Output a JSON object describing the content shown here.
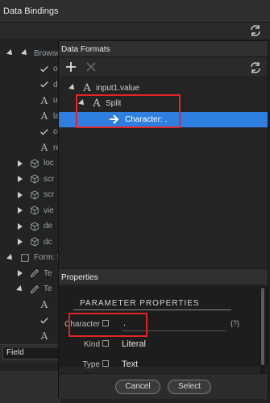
{
  "outer": {
    "title": "Data Bindings",
    "tree": [
      {
        "label": "Browse",
        "icon": "triangle-down-icon",
        "indent": 0
      },
      {
        "label": "on",
        "icon": "check-icon",
        "indent": 2
      },
      {
        "label": "dc",
        "icon": "check-icon",
        "indent": 2
      },
      {
        "label": "us",
        "icon": "font-a-icon",
        "indent": 2
      },
      {
        "label": "lar",
        "icon": "font-a-icon",
        "indent": 2
      },
      {
        "label": "co",
        "icon": "check-icon",
        "indent": 2
      },
      {
        "label": "ref",
        "icon": "font-a-icon",
        "indent": 2
      },
      {
        "label": "loc",
        "icon": "cube-icon",
        "indent": 1
      },
      {
        "label": "scr",
        "icon": "cube-icon",
        "indent": 1
      },
      {
        "label": "scr",
        "icon": "cube-icon",
        "indent": 1
      },
      {
        "label": "vie",
        "icon": "cube-icon",
        "indent": 1
      },
      {
        "label": "de",
        "icon": "cube-icon",
        "indent": 1
      },
      {
        "label": "dc",
        "icon": "cube-icon",
        "indent": 1
      },
      {
        "label": "Form: f",
        "icon": "form-icon",
        "indent": 0
      },
      {
        "label": "Te",
        "icon": "pencil-icon",
        "indent": 1
      },
      {
        "label": "Te",
        "icon": "pencil-icon",
        "indent": 1
      },
      {
        "label": "",
        "icon": "font-a-icon",
        "indent": 2
      },
      {
        "label": "",
        "icon": "check-icon",
        "indent": 2
      },
      {
        "label": "",
        "icon": "font-a-icon",
        "indent": 2
      }
    ],
    "field_select": "Field"
  },
  "data_formats": {
    "title": "Data Formats",
    "add_icon": "plus-icon",
    "remove_icon": "close-icon",
    "refresh_icon": "refresh-icon",
    "rows": [
      {
        "label": "input1.value",
        "icon": "font-a-icon"
      },
      {
        "label": "Split",
        "icon": "font-a-icon"
      },
      {
        "label": "Character: .",
        "icon": "arrow-right-icon"
      }
    ]
  },
  "properties": {
    "title": "Properties",
    "heading": "PARAMETER PROPERTIES",
    "fields": [
      {
        "label": "Character",
        "value": "."
      },
      {
        "label": "Kind",
        "value": "Literal"
      },
      {
        "label": "Type",
        "value": "Text"
      }
    ],
    "variable_icon": "{?}"
  },
  "buttons": {
    "cancel": "Cancel",
    "select": "Select"
  },
  "colors": {
    "selection": "#2f7fe0",
    "highlight_box": "#e2232a"
  }
}
